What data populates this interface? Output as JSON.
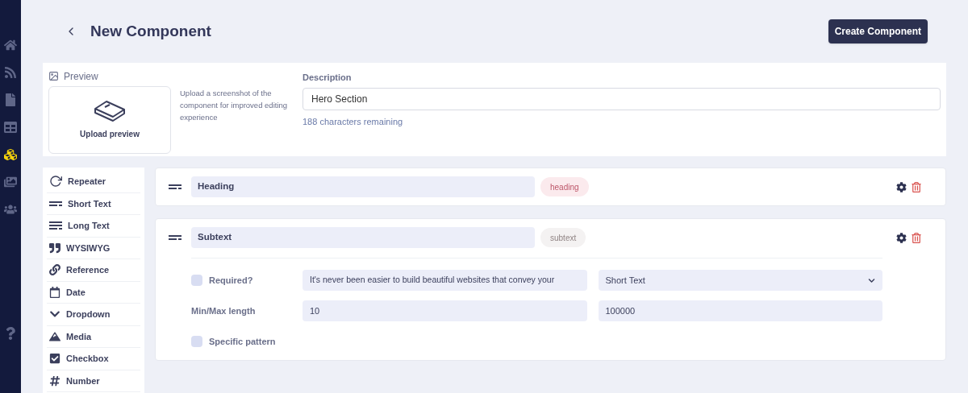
{
  "nav": [
    {
      "selected": false
    },
    {
      "selected": false
    },
    {
      "selected": false
    },
    {
      "selected": false
    },
    {
      "selected": true
    },
    {
      "selected": false
    },
    {
      "selected": false
    },
    {
      "selected": false
    }
  ],
  "header": {
    "title": "New Component",
    "button": "Create Component"
  },
  "preview": {
    "label": "Preview",
    "upload": "Upload preview",
    "hint": "Upload a screenshot of the component for improved editing experience"
  },
  "description": {
    "label": "Description",
    "value": "Hero Section",
    "remaining": "188 characters remaining"
  },
  "field_types": [
    {
      "label": "Repeater"
    },
    {
      "label": "Short Text"
    },
    {
      "label": "Long Text"
    },
    {
      "label": "WYSIWYG"
    },
    {
      "label": "Reference"
    },
    {
      "label": "Date"
    },
    {
      "label": "Dropdown"
    },
    {
      "label": "Media"
    },
    {
      "label": "Checkbox"
    },
    {
      "label": "Number"
    }
  ],
  "fields": [
    {
      "name": "Heading",
      "api_id": "heading",
      "color": "#fbeaed"
    },
    {
      "name": "Subtext",
      "api_id": "subtext",
      "color": "#f4f2f2",
      "settings": {
        "required": {
          "label": "Required?",
          "checked": false
        },
        "default": "It's never been easier to build beautiful websites that convey your",
        "type": "Short Text",
        "length_label": "Min/Max length",
        "min": "10",
        "max": "100000",
        "pattern": {
          "label": "Specific pattern",
          "checked": false
        }
      }
    }
  ]
}
